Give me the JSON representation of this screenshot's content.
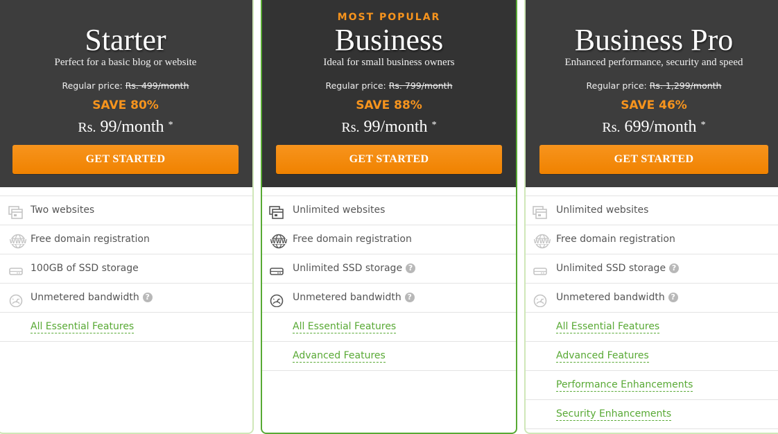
{
  "plans": [
    {
      "badge": "",
      "name": "Starter",
      "tagline": "Perfect for a basic blog or website",
      "regular_label": "Regular price:",
      "regular_price": "Rs. 499/month",
      "save": "SAVE 80%",
      "price_currency": "Rs.",
      "price_amount": "99/month",
      "price_asterisk": "*",
      "cta": "GET STARTED",
      "features": [
        {
          "icon": "websites-icon",
          "text": "Two websites",
          "help": false
        },
        {
          "icon": "www-globe-icon",
          "text": "Free domain registration",
          "help": false
        },
        {
          "icon": "ssd-drive-icon",
          "text": "100GB of SSD storage",
          "help": false
        },
        {
          "icon": "speedometer-icon",
          "text": "Unmetered bandwidth",
          "help": true
        }
      ],
      "links": [
        "All Essential Features"
      ]
    },
    {
      "badge": "MOST POPULAR",
      "name": "Business",
      "tagline": "Ideal for small business owners",
      "regular_label": "Regular price:",
      "regular_price": "Rs. 799/month",
      "save": "SAVE 88%",
      "price_currency": "Rs.",
      "price_amount": "99/month",
      "price_asterisk": "*",
      "cta": "GET STARTED",
      "features": [
        {
          "icon": "websites-icon",
          "text": "Unlimited websites",
          "help": false
        },
        {
          "icon": "www-globe-icon",
          "text": "Free domain registration",
          "help": false
        },
        {
          "icon": "ssd-drive-icon",
          "text": "Unlimited SSD storage",
          "help": true
        },
        {
          "icon": "speedometer-icon",
          "text": "Unmetered bandwidth",
          "help": true
        }
      ],
      "links": [
        "All Essential Features",
        "Advanced Features"
      ]
    },
    {
      "badge": "",
      "name": "Business Pro",
      "tagline": "Enhanced performance, security and speed",
      "regular_label": "Regular price:",
      "regular_price": "Rs. 1,299/month",
      "save": "SAVE 46%",
      "price_currency": "Rs.",
      "price_amount": "699/month",
      "price_asterisk": "*",
      "cta": "GET STARTED",
      "features": [
        {
          "icon": "websites-icon",
          "text": "Unlimited websites",
          "help": false
        },
        {
          "icon": "www-globe-icon",
          "text": "Free domain registration",
          "help": false
        },
        {
          "icon": "ssd-drive-icon",
          "text": "Unlimited SSD storage",
          "help": true
        },
        {
          "icon": "speedometer-icon",
          "text": "Unmetered bandwidth",
          "help": true
        }
      ],
      "links": [
        "All Essential Features",
        "Advanced Features",
        "Performance Enhancements",
        "Security Enhancements"
      ]
    }
  ],
  "help_glyph": "?",
  "colors": {
    "header_bg": "#3d3d3d",
    "accent_orange": "#f7941d",
    "link_green": "#58a934",
    "popular_border": "#58a934"
  }
}
